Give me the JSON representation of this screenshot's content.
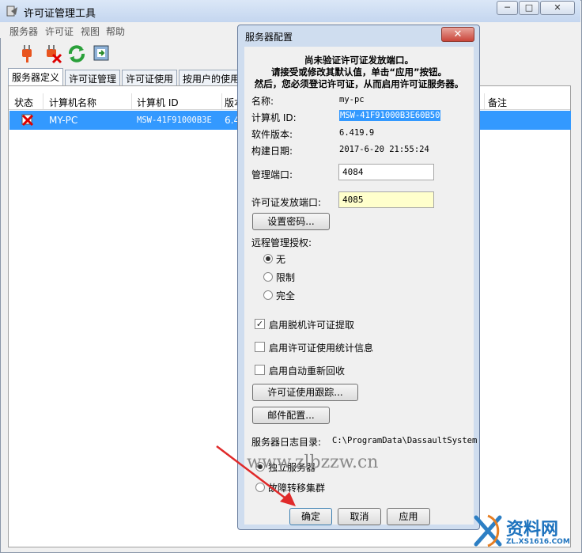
{
  "window": {
    "title": "许可证管理工具",
    "min": "─",
    "max": "□",
    "close": "✕"
  },
  "menu": [
    "服务器",
    "许可证",
    "视图",
    "帮助"
  ],
  "tabs": [
    "服务器定义",
    "许可证管理",
    "许可证使用",
    "按用户的使用"
  ],
  "columns": [
    "状态",
    "计算机名称",
    "计算机 ID",
    "版本",
    "备注"
  ],
  "row": {
    "name": "MY-PC",
    "id": "MSW-41F91000B3E",
    "version": "6.4"
  },
  "dialog": {
    "title": "服务器配置",
    "close": "✕",
    "notice": [
      "尚未验证许可证发放端口。",
      "请接受或修改其默认值，单击“应用”按钮。",
      "然后，您必须登记许可证，从而启用许可证服务器。"
    ],
    "name_label": "名称:",
    "name_value": "my-pc",
    "id_label": "计算机 ID:",
    "id_value": "MSW-41F91000B3E60B50",
    "ver_label": "软件版本:",
    "ver_value": "6.419.9",
    "build_label": "构建日期:",
    "build_value": "2017-6-20 21:55:24",
    "admin_port_label": "管理端口:",
    "admin_port": "4084",
    "license_port_label": "许可证发放端口:",
    "license_port": "4085",
    "set_password": "设置密码...",
    "remote_label": "远程管理授权:",
    "remote_options": [
      "无",
      "限制",
      "完全"
    ],
    "checks": [
      "启用脱机许可证提取",
      "启用许可证使用统计信息",
      "启用自动重新回收"
    ],
    "tracking_button": "许可证使用跟踪...",
    "mail_button": "邮件配置...",
    "log_label": "服务器日志目录:",
    "log_value": "C:\\ProgramData\\DassaultSystem",
    "server_modes": [
      "独立服务器",
      "故障转移集群"
    ],
    "ok": "确定",
    "cancel": "取消",
    "apply": "应用"
  },
  "watermark": {
    "text": "www.zlbzzw.cn",
    "logo_text": "资料网",
    "logo_sub": "ZL.XS1616.COM"
  }
}
